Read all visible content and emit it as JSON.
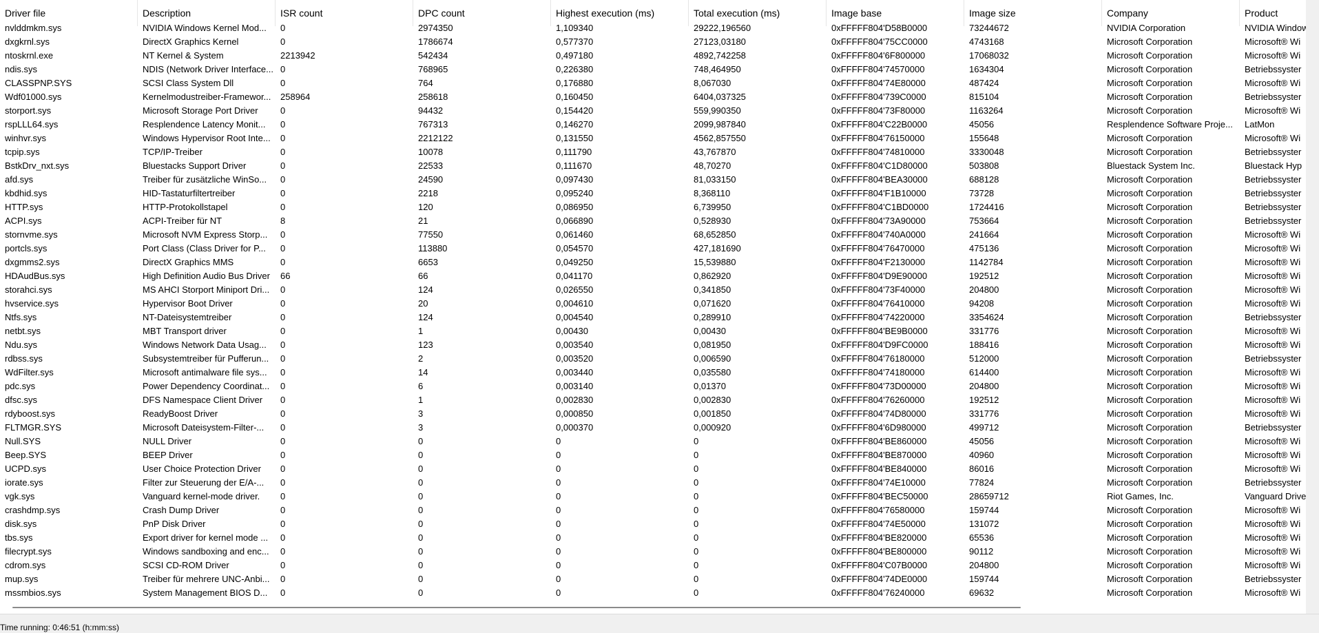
{
  "columns": [
    "Driver file",
    "Description",
    "ISR count",
    "DPC count",
    "Highest execution (ms)",
    "Total execution (ms)",
    "Image base",
    "Image size",
    "Company",
    "Product"
  ],
  "rows": [
    [
      "nvlddmkm.sys",
      "NVIDIA Windows Kernel Mod...",
      "0",
      "2974350",
      "1,109340",
      "29222,196560",
      "0xFFFFF804'D58B0000",
      "73244672",
      "NVIDIA Corporation",
      "NVIDIA Window"
    ],
    [
      "dxgkrnl.sys",
      "DirectX Graphics Kernel",
      "0",
      "1786674",
      "0,577370",
      "27123,03180",
      "0xFFFFF804'75CC0000",
      "4743168",
      "Microsoft Corporation",
      "Microsoft® Wi"
    ],
    [
      "ntoskrnl.exe",
      "NT Kernel & System",
      "2213942",
      "542434",
      "0,497180",
      "4892,742258",
      "0xFFFFF804'6F800000",
      "17068032",
      "Microsoft Corporation",
      "Microsoft® Wi"
    ],
    [
      "ndis.sys",
      "NDIS (Network Driver Interface...",
      "0",
      "768965",
      "0,226380",
      "748,464950",
      "0xFFFFF804'74570000",
      "1634304",
      "Microsoft Corporation",
      "Betriebssyster"
    ],
    [
      "CLASSPNP.SYS",
      "SCSI Class System Dll",
      "0",
      "764",
      "0,176880",
      "8,067030",
      "0xFFFFF804'74E80000",
      "487424",
      "Microsoft Corporation",
      "Microsoft® Wi"
    ],
    [
      "Wdf01000.sys",
      "Kernelmodustreiber-Framewor...",
      "258964",
      "258618",
      "0,160450",
      "6404,037325",
      "0xFFFFF804'739C0000",
      "815104",
      "Microsoft Corporation",
      "Betriebssyster"
    ],
    [
      "storport.sys",
      "Microsoft Storage Port Driver",
      "0",
      "94432",
      "0,154420",
      "559,990350",
      "0xFFFFF804'73F80000",
      "1163264",
      "Microsoft Corporation",
      "Microsoft® Wi"
    ],
    [
      "rspLLL64.sys",
      "Resplendence Latency Monit...",
      "0",
      "767313",
      "0,146270",
      "2099,987840",
      "0xFFFFF804'C22B0000",
      "45056",
      "Resplendence Software Proje...",
      "LatMon"
    ],
    [
      "winhvr.sys",
      "Windows Hypervisor Root Inte...",
      "0",
      "2212122",
      "0,131550",
      "4562,857550",
      "0xFFFFF804'76150000",
      "155648",
      "Microsoft Corporation",
      "Microsoft® Wi"
    ],
    [
      "tcpip.sys",
      "TCP/IP-Treiber",
      "0",
      "10078",
      "0,111790",
      "43,767870",
      "0xFFFFF804'74810000",
      "3330048",
      "Microsoft Corporation",
      "Betriebssyster"
    ],
    [
      "BstkDrv_nxt.sys",
      "Bluestacks Support Driver",
      "0",
      "22533",
      "0,111670",
      "48,70270",
      "0xFFFFF804'C1D80000",
      "503808",
      "Bluestack System Inc.",
      "Bluestack Hyp"
    ],
    [
      "afd.sys",
      "Treiber für zusätzliche WinSo...",
      "0",
      "24590",
      "0,097430",
      "81,033150",
      "0xFFFFF804'BEA30000",
      "688128",
      "Microsoft Corporation",
      "Betriebssyster"
    ],
    [
      "kbdhid.sys",
      "HID-Tastaturfiltertreiber",
      "0",
      "2218",
      "0,095240",
      "8,368110",
      "0xFFFFF804'F1B10000",
      "73728",
      "Microsoft Corporation",
      "Betriebssyster"
    ],
    [
      "HTTP.sys",
      "HTTP-Protokollstapel",
      "0",
      "120",
      "0,086950",
      "6,739950",
      "0xFFFFF804'C1BD0000",
      "1724416",
      "Microsoft Corporation",
      "Betriebssyster"
    ],
    [
      "ACPI.sys",
      "ACPI-Treiber für NT",
      "8",
      "21",
      "0,066890",
      "0,528930",
      "0xFFFFF804'73A90000",
      "753664",
      "Microsoft Corporation",
      "Betriebssyster"
    ],
    [
      "stornvme.sys",
      "Microsoft NVM Express Storp...",
      "0",
      "77550",
      "0,061460",
      "68,652850",
      "0xFFFFF804'740A0000",
      "241664",
      "Microsoft Corporation",
      "Microsoft® Wi"
    ],
    [
      "portcls.sys",
      "Port Class (Class Driver for P...",
      "0",
      "113880",
      "0,054570",
      "427,181690",
      "0xFFFFF804'76470000",
      "475136",
      "Microsoft Corporation",
      "Microsoft® Wi"
    ],
    [
      "dxgmms2.sys",
      "DirectX Graphics MMS",
      "0",
      "6653",
      "0,049250",
      "15,539880",
      "0xFFFFF804'F2130000",
      "1142784",
      "Microsoft Corporation",
      "Microsoft® Wi"
    ],
    [
      "HDAudBus.sys",
      "High Definition Audio Bus Driver",
      "66",
      "66",
      "0,041170",
      "0,862920",
      "0xFFFFF804'D9E90000",
      "192512",
      "Microsoft Corporation",
      "Microsoft® Wi"
    ],
    [
      "storahci.sys",
      "MS AHCI Storport Miniport Dri...",
      "0",
      "124",
      "0,026550",
      "0,341850",
      "0xFFFFF804'73F40000",
      "204800",
      "Microsoft Corporation",
      "Microsoft® Wi"
    ],
    [
      "hvservice.sys",
      "Hypervisor Boot Driver",
      "0",
      "20",
      "0,004610",
      "0,071620",
      "0xFFFFF804'76410000",
      "94208",
      "Microsoft Corporation",
      "Microsoft® Wi"
    ],
    [
      "Ntfs.sys",
      "NT-Dateisystemtreiber",
      "0",
      "124",
      "0,004540",
      "0,289910",
      "0xFFFFF804'74220000",
      "3354624",
      "Microsoft Corporation",
      "Betriebssyster"
    ],
    [
      "netbt.sys",
      "MBT Transport driver",
      "0",
      "1",
      "0,00430",
      "0,00430",
      "0xFFFFF804'BE9B0000",
      "331776",
      "Microsoft Corporation",
      "Microsoft® Wi"
    ],
    [
      "Ndu.sys",
      "Windows Network Data Usag...",
      "0",
      "123",
      "0,003540",
      "0,081950",
      "0xFFFFF804'D9FC0000",
      "188416",
      "Microsoft Corporation",
      "Microsoft® Wi"
    ],
    [
      "rdbss.sys",
      "Subsystemtreiber für Pufferun...",
      "0",
      "2",
      "0,003520",
      "0,006590",
      "0xFFFFF804'76180000",
      "512000",
      "Microsoft Corporation",
      "Betriebssyster"
    ],
    [
      "WdFilter.sys",
      "Microsoft antimalware file sys...",
      "0",
      "14",
      "0,003440",
      "0,035580",
      "0xFFFFF804'74180000",
      "614400",
      "Microsoft Corporation",
      "Microsoft® Wi"
    ],
    [
      "pdc.sys",
      "Power Dependency Coordinat...",
      "0",
      "6",
      "0,003140",
      "0,01370",
      "0xFFFFF804'73D00000",
      "204800",
      "Microsoft Corporation",
      "Microsoft® Wi"
    ],
    [
      "dfsc.sys",
      "DFS Namespace Client Driver",
      "0",
      "1",
      "0,002830",
      "0,002830",
      "0xFFFFF804'76260000",
      "192512",
      "Microsoft Corporation",
      "Microsoft® Wi"
    ],
    [
      "rdyboost.sys",
      "ReadyBoost Driver",
      "0",
      "3",
      "0,000850",
      "0,001850",
      "0xFFFFF804'74D80000",
      "331776",
      "Microsoft Corporation",
      "Microsoft® Wi"
    ],
    [
      "FLTMGR.SYS",
      "Microsoft Dateisystem-Filter-...",
      "0",
      "3",
      "0,000370",
      "0,000920",
      "0xFFFFF804'6D980000",
      "499712",
      "Microsoft Corporation",
      "Betriebssyster"
    ],
    [
      "Null.SYS",
      "NULL Driver",
      "0",
      "0",
      "0",
      "0",
      "0xFFFFF804'BE860000",
      "45056",
      "Microsoft Corporation",
      "Microsoft® Wi"
    ],
    [
      "Beep.SYS",
      "BEEP Driver",
      "0",
      "0",
      "0",
      "0",
      "0xFFFFF804'BE870000",
      "40960",
      "Microsoft Corporation",
      "Microsoft® Wi"
    ],
    [
      "UCPD.sys",
      "User Choice Protection Driver",
      "0",
      "0",
      "0",
      "0",
      "0xFFFFF804'BE840000",
      "86016",
      "Microsoft Corporation",
      "Microsoft® Wi"
    ],
    [
      "iorate.sys",
      "Filter zur Steuerung der E/A-...",
      "0",
      "0",
      "0",
      "0",
      "0xFFFFF804'74E10000",
      "77824",
      "Microsoft Corporation",
      "Betriebssyster"
    ],
    [
      "vgk.sys",
      "Vanguard kernel-mode driver.",
      "0",
      "0",
      "0",
      "0",
      "0xFFFFF804'BEC50000",
      "28659712",
      "Riot Games, Inc.",
      "Vanguard Drive"
    ],
    [
      "crashdmp.sys",
      "Crash Dump Driver",
      "0",
      "0",
      "0",
      "0",
      "0xFFFFF804'76580000",
      "159744",
      "Microsoft Corporation",
      "Microsoft® Wi"
    ],
    [
      "disk.sys",
      "PnP Disk Driver",
      "0",
      "0",
      "0",
      "0",
      "0xFFFFF804'74E50000",
      "131072",
      "Microsoft Corporation",
      "Microsoft® Wi"
    ],
    [
      "tbs.sys",
      "Export driver for kernel mode ...",
      "0",
      "0",
      "0",
      "0",
      "0xFFFFF804'BE820000",
      "65536",
      "Microsoft Corporation",
      "Microsoft® Wi"
    ],
    [
      "filecrypt.sys",
      "Windows sandboxing and enc...",
      "0",
      "0",
      "0",
      "0",
      "0xFFFFF804'BE800000",
      "90112",
      "Microsoft Corporation",
      "Microsoft® Wi"
    ],
    [
      "cdrom.sys",
      "SCSI CD-ROM Driver",
      "0",
      "0",
      "0",
      "0",
      "0xFFFFF804'C07B0000",
      "204800",
      "Microsoft Corporation",
      "Microsoft® Wi"
    ],
    [
      "mup.sys",
      "Treiber für mehrere UNC-Anbi...",
      "0",
      "0",
      "0",
      "0",
      "0xFFFFF804'74DE0000",
      "159744",
      "Microsoft Corporation",
      "Betriebssyster"
    ],
    [
      "mssmbios.sys",
      "System Management BIOS D...",
      "0",
      "0",
      "0",
      "0",
      "0xFFFFF804'76240000",
      "69632",
      "Microsoft Corporation",
      "Microsoft® Wi"
    ]
  ],
  "status": {
    "text": "Time running: 0:46:51  (h:mm:ss)"
  }
}
